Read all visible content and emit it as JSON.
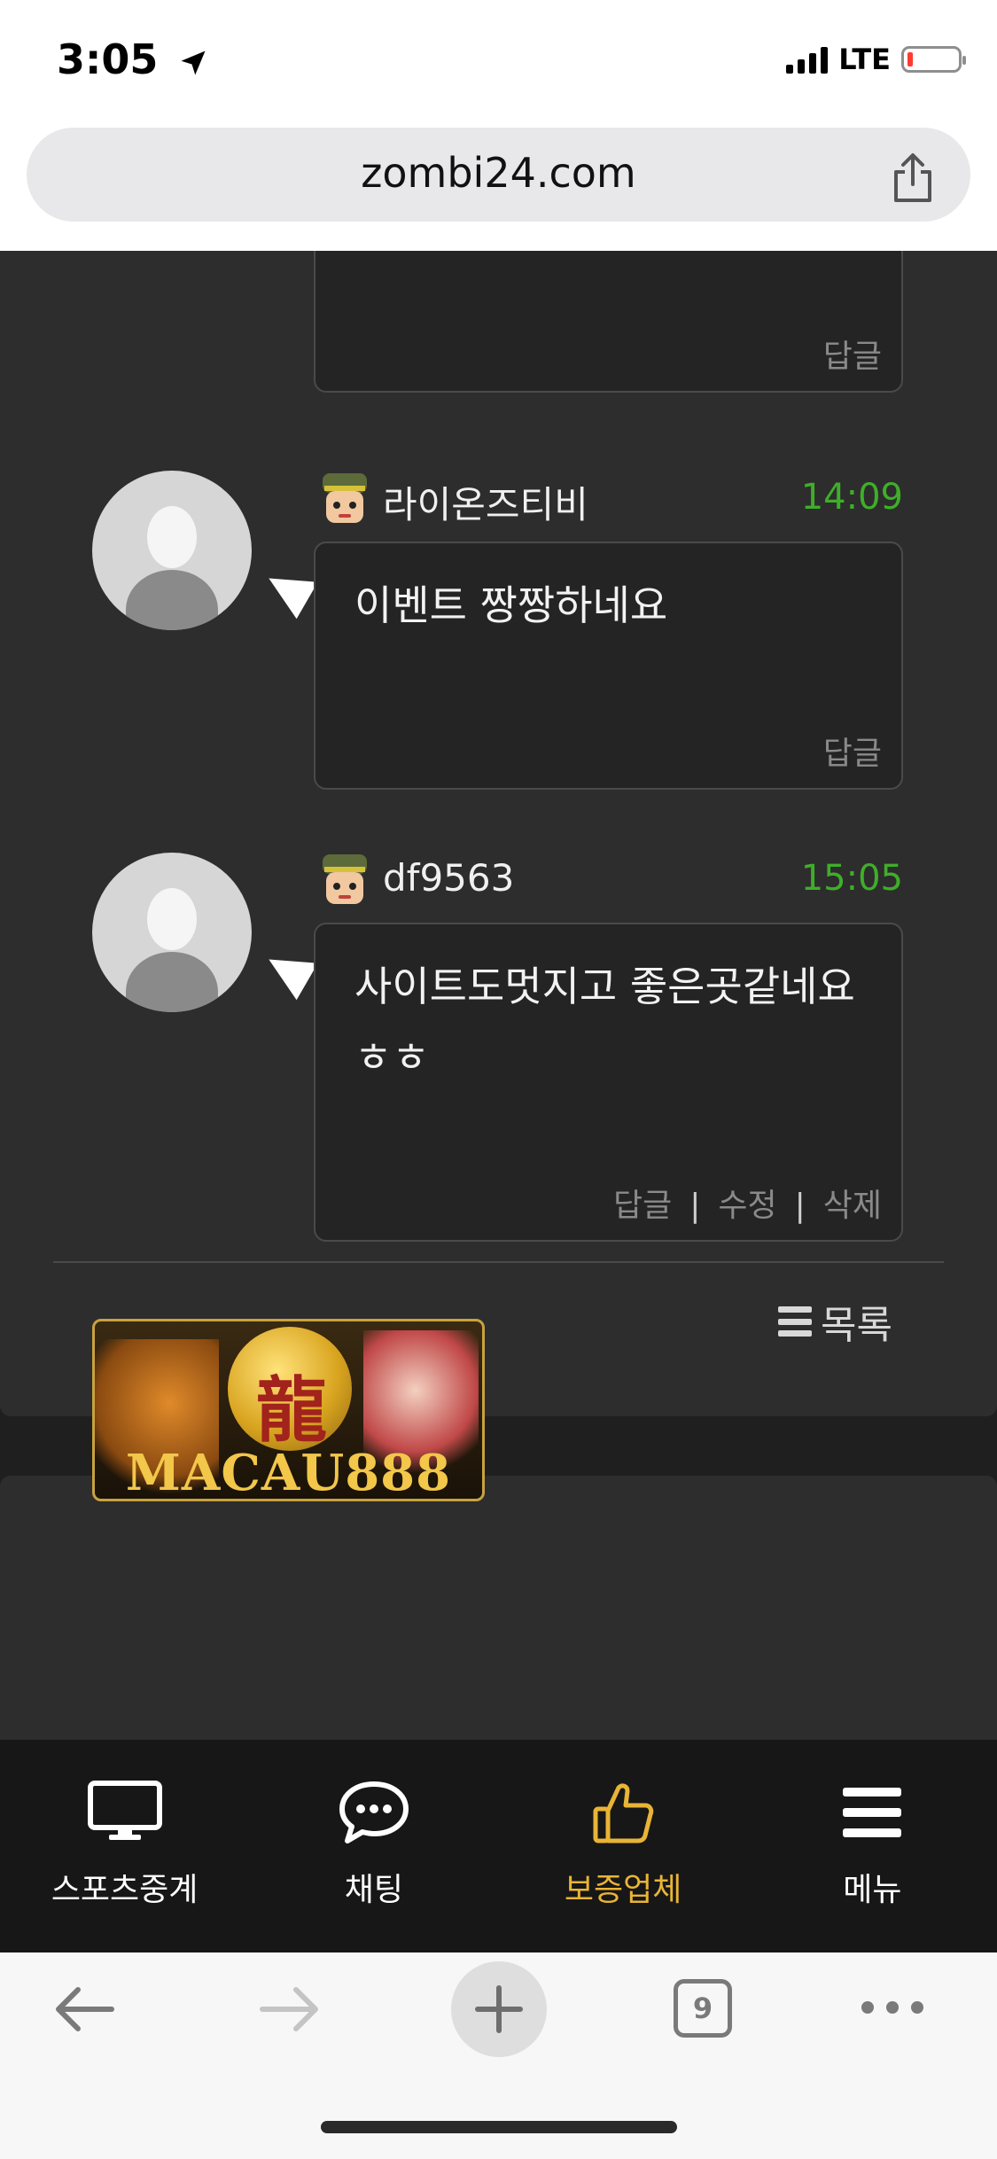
{
  "status": {
    "time": "3:05",
    "network": "LTE"
  },
  "browser": {
    "url": "zombi24.com",
    "tab_count": "9"
  },
  "comments": [
    {
      "reply_label": "답글"
    },
    {
      "username": "라이온즈티비",
      "time": "14:09",
      "text": "이벤트 짱짱하네요",
      "reply_label": "답글"
    },
    {
      "username": "df9563",
      "time": "15:05",
      "text_line1": "사이트도멋지고 좋은곳같네요",
      "text_line2": "ㅎㅎ",
      "reply_label": "답글",
      "edit_label": "수정",
      "delete_label": "삭제"
    }
  ],
  "list_button": {
    "label": "목록"
  },
  "banner": {
    "brand": "MACAU888"
  },
  "bottom_nav": {
    "items": [
      {
        "label": "스포츠중계",
        "icon": "monitor-icon"
      },
      {
        "label": "채팅",
        "icon": "chat-bubble-icon"
      },
      {
        "label": "보증업체",
        "icon": "thumbs-up-icon"
      },
      {
        "label": "메뉴",
        "icon": "hamburger-icon"
      }
    ],
    "active_index": 2
  },
  "colors": {
    "accent": "#e9b436",
    "time": "#3fae2a",
    "card": "#2d2d2d",
    "background": "#1f1f1f"
  }
}
